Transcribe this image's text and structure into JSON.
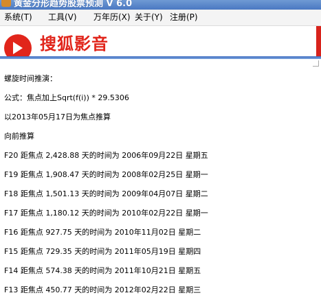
{
  "window": {
    "title": "黄金分形趋势股票预测  V 6.0"
  },
  "menu": [
    {
      "label": "系统(T)"
    },
    {
      "label": "工具(V)"
    },
    {
      "label": "万年历(X)"
    },
    {
      "label": "关于(Y)"
    },
    {
      "label": "注册(P)"
    }
  ],
  "banner": {
    "logo_text": "搜狐影音",
    "logo_color": "#e1251b"
  },
  "content": {
    "heading": "螺旋时间推演：",
    "formula": "公式：焦点加上Sqrt(f(i)) * 29.5306",
    "base": "以2013年05月17日为焦点推算",
    "direction": "向前推算",
    "results": [
      "F20 距焦点 2,428.88 天的时间为 2006年09月22日  星期五",
      "F19 距焦点 1,908.47 天的时间为 2008年02月25日  星期一",
      "F18 距焦点 1,501.13 天的时间为 2009年04月07日  星期二",
      "F17 距焦点 1,180.12 天的时间为 2010年02月22日  星期一",
      "F16 距焦点 927.75 天的时间为 2010年11月02日  星期二",
      "F15 距焦点 729.35 天的时间为 2011年05月19日  星期四",
      "F14 距焦点 574.38 天的时间为 2011年10月21日  星期五",
      "F13 距焦点 450.77 天的时间为 2012年02月22日  星期三"
    ]
  }
}
